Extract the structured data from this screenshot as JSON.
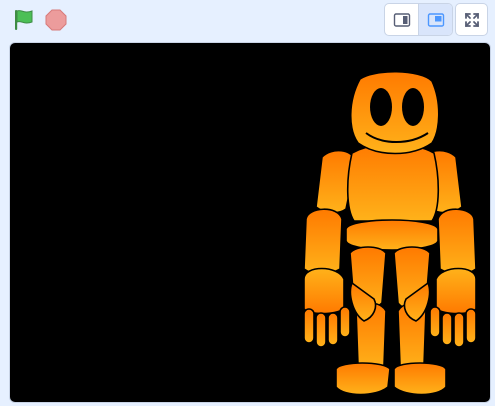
{
  "controls": {
    "green_flag": "green-flag-icon",
    "stop": "stop-sign-icon",
    "small_stage": "small-stage-icon",
    "normal_stage": "normal-stage-icon",
    "fullscreen": "fullscreen-icon"
  },
  "colors": {
    "flag_green": "#4cbf56",
    "stop_red": "#ec9c9c",
    "accent_blue": "#4c97ff",
    "stage_background": "#000000",
    "sprite_orange_top": "#ff7a00",
    "sprite_orange_bottom": "#ffb21a"
  },
  "stage": {
    "sprite": "orange-robot-sprite"
  }
}
